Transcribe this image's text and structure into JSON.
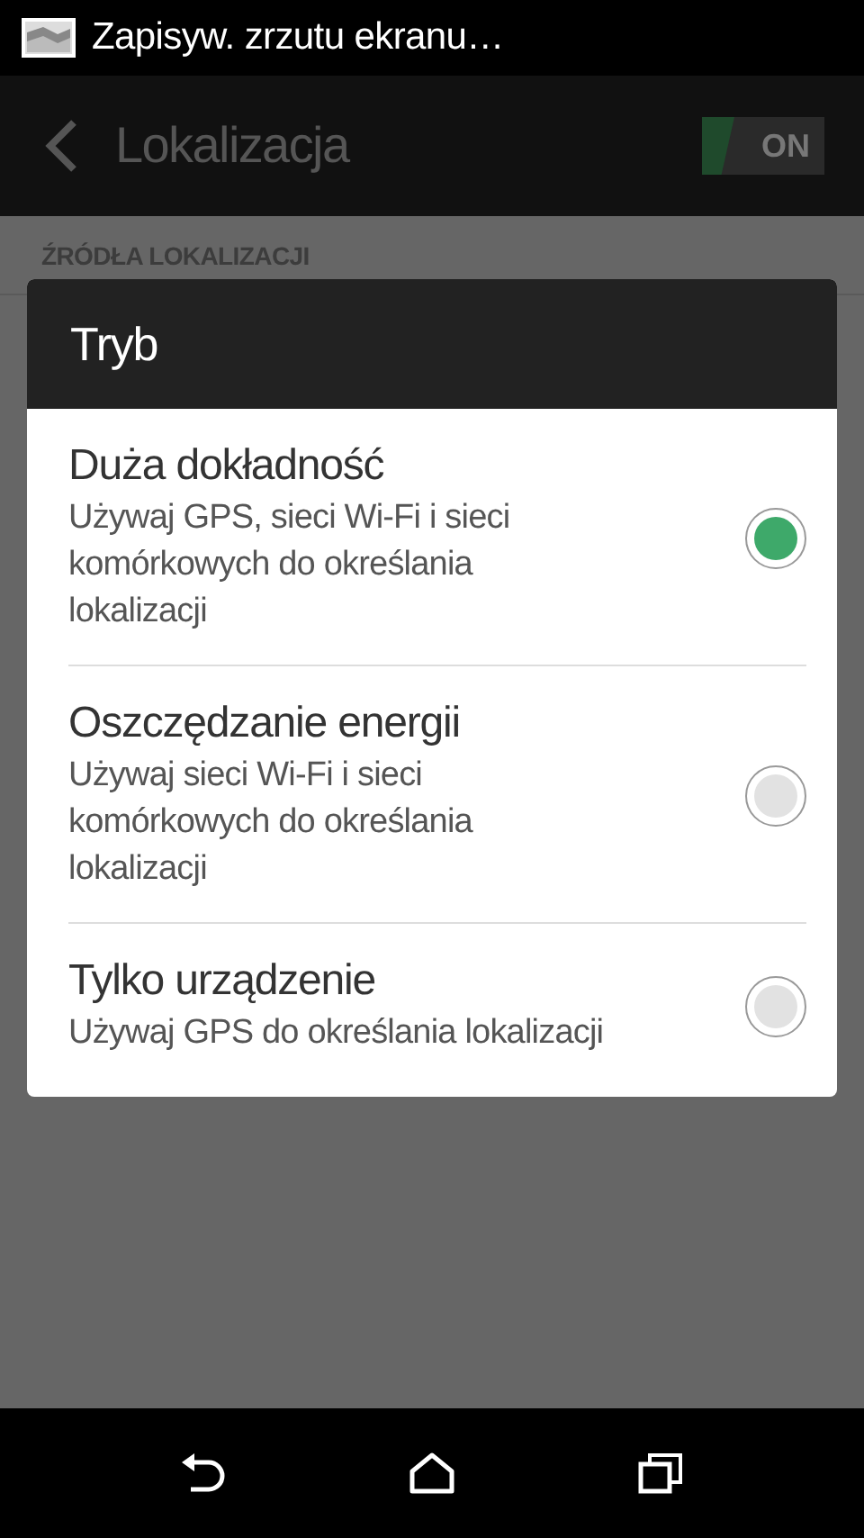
{
  "status_bar": {
    "notification": "Zapisyw. zrzutu ekranu…"
  },
  "app_bar": {
    "title": "Lokalizacja",
    "toggle": {
      "label": "ON",
      "on": true
    }
  },
  "section_header": "ŹRÓDŁA LOKALIZACJI",
  "dialog": {
    "title": "Tryb",
    "options": [
      {
        "title": "Duża dokładność",
        "description": "Używaj GPS, sieci Wi-Fi i sieci komórkowych do określania lokalizacji",
        "selected": true
      },
      {
        "title": "Oszczędzanie energii",
        "description": "Używaj sieci Wi-Fi i sieci komórkowych do określania lokalizacji",
        "selected": false
      },
      {
        "title": "Tylko urządzenie",
        "description": "Używaj GPS do określania lokalizacji",
        "selected": false
      }
    ]
  }
}
